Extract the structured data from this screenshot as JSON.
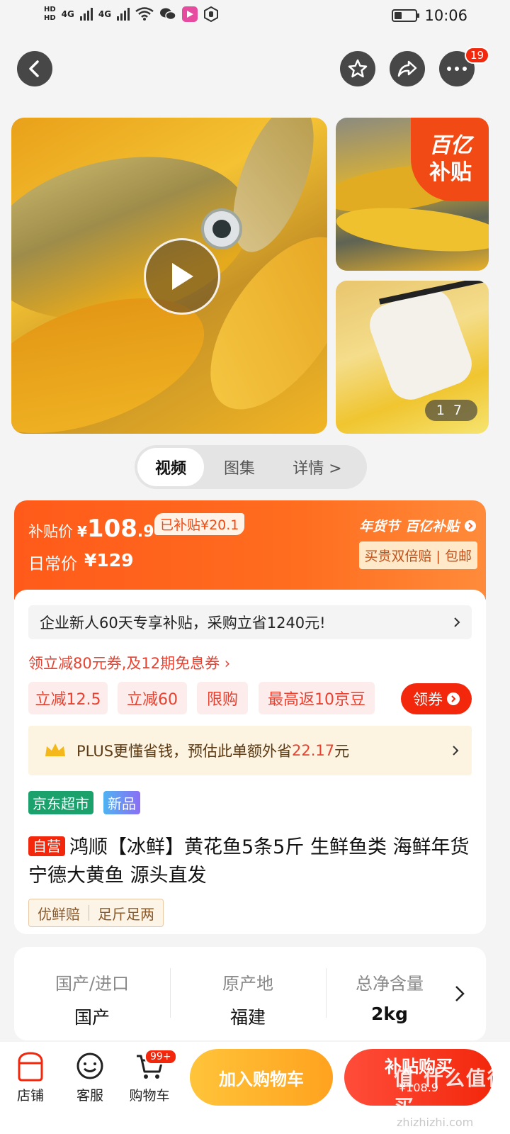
{
  "status_bar": {
    "hd1": "HD",
    "hd2": "HD",
    "net1": "4G",
    "net2": "4G",
    "time": "10:06"
  },
  "top_nav": {
    "more_badge": "19"
  },
  "gallery": {
    "subsidy_tag_line1": "百亿",
    "subsidy_tag_line2": "补贴",
    "pager_current": "1",
    "pager_total": "7"
  },
  "media_tabs": [
    "视频",
    "图集",
    "详情 >"
  ],
  "price": {
    "subsidy_label": "补贴价",
    "currency": "¥",
    "subsidy_price_int": "108",
    "subsidy_price_dec": ".9",
    "subsidized_amount": "已补贴¥20.1",
    "daily_label": "日常价",
    "daily_price": "¥129",
    "festival_tag": "年货节",
    "campaign_tag": "百亿补贴",
    "guarantee": "买贵双倍赔 | 包邮"
  },
  "promo": {
    "enterprise_banner": "企业新人60天专享补贴，采购立省1240元!",
    "coupon_link": "领立减80元券,及12期免息券 ›",
    "pills": [
      "立减12.5",
      "立减60",
      "限购",
      "最高返10京豆"
    ],
    "get_coupon": "领券",
    "plus_text_a": "PLUS更懂省钱，预估此单额外省",
    "plus_amount": "22.17",
    "plus_text_b": "元"
  },
  "product": {
    "store_tag": "京东超市",
    "new_tag": "新品",
    "self_tag": "自营",
    "title": "鸿顺【冰鲜】黄花鱼5条5斤 生鲜鱼类 海鲜年货 宁德大黄鱼 源头直发",
    "service_tags": [
      "优鲜赔",
      "足斤足两"
    ]
  },
  "attributes": [
    {
      "key": "国产/进口",
      "value": "国产"
    },
    {
      "key": "原产地",
      "value": "福建"
    },
    {
      "key": "总净含量",
      "value": "2kg"
    }
  ],
  "bottom_bar": {
    "shop": "店铺",
    "service": "客服",
    "cart": "购物车",
    "cart_badge": "99+",
    "add_to_cart": "加入购物车",
    "buy_label": "补贴购买",
    "buy_price": "¥108.9",
    "watermark": "值 什么值得买",
    "watermark_url": "zhizhizhi.com"
  },
  "colors": {
    "accent": "#f2270c",
    "orange": "#ff5a1a",
    "cart_btn": "#ffb02e"
  }
}
